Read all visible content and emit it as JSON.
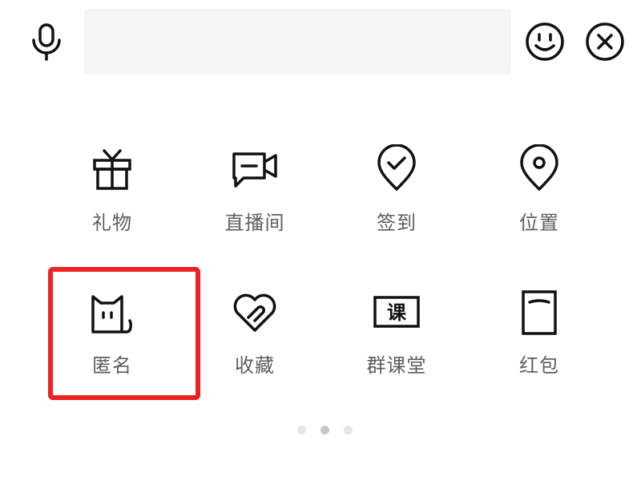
{
  "topbar": {
    "voice_icon": "microphone-icon",
    "input_value": "",
    "input_placeholder": "",
    "emoji_icon": "smiley-icon",
    "close_icon": "close-circle-icon"
  },
  "features": [
    {
      "label": "礼物",
      "icon": "gift-icon"
    },
    {
      "label": "直播间",
      "icon": "video-camera-icon"
    },
    {
      "label": "签到",
      "icon": "check-in-pin-icon"
    },
    {
      "label": "位置",
      "icon": "location-pin-icon"
    },
    {
      "label": "匿名",
      "icon": "cat-icon"
    },
    {
      "label": "收藏",
      "icon": "heart-clip-icon"
    },
    {
      "label": "群课堂",
      "icon": "class-icon"
    },
    {
      "label": "红包",
      "icon": "red-packet-icon"
    }
  ],
  "class_icon_text": "课",
  "highlight": {
    "target": "匿名",
    "color": "#ee2222"
  },
  "pager": {
    "pages": 3,
    "current": 2
  }
}
